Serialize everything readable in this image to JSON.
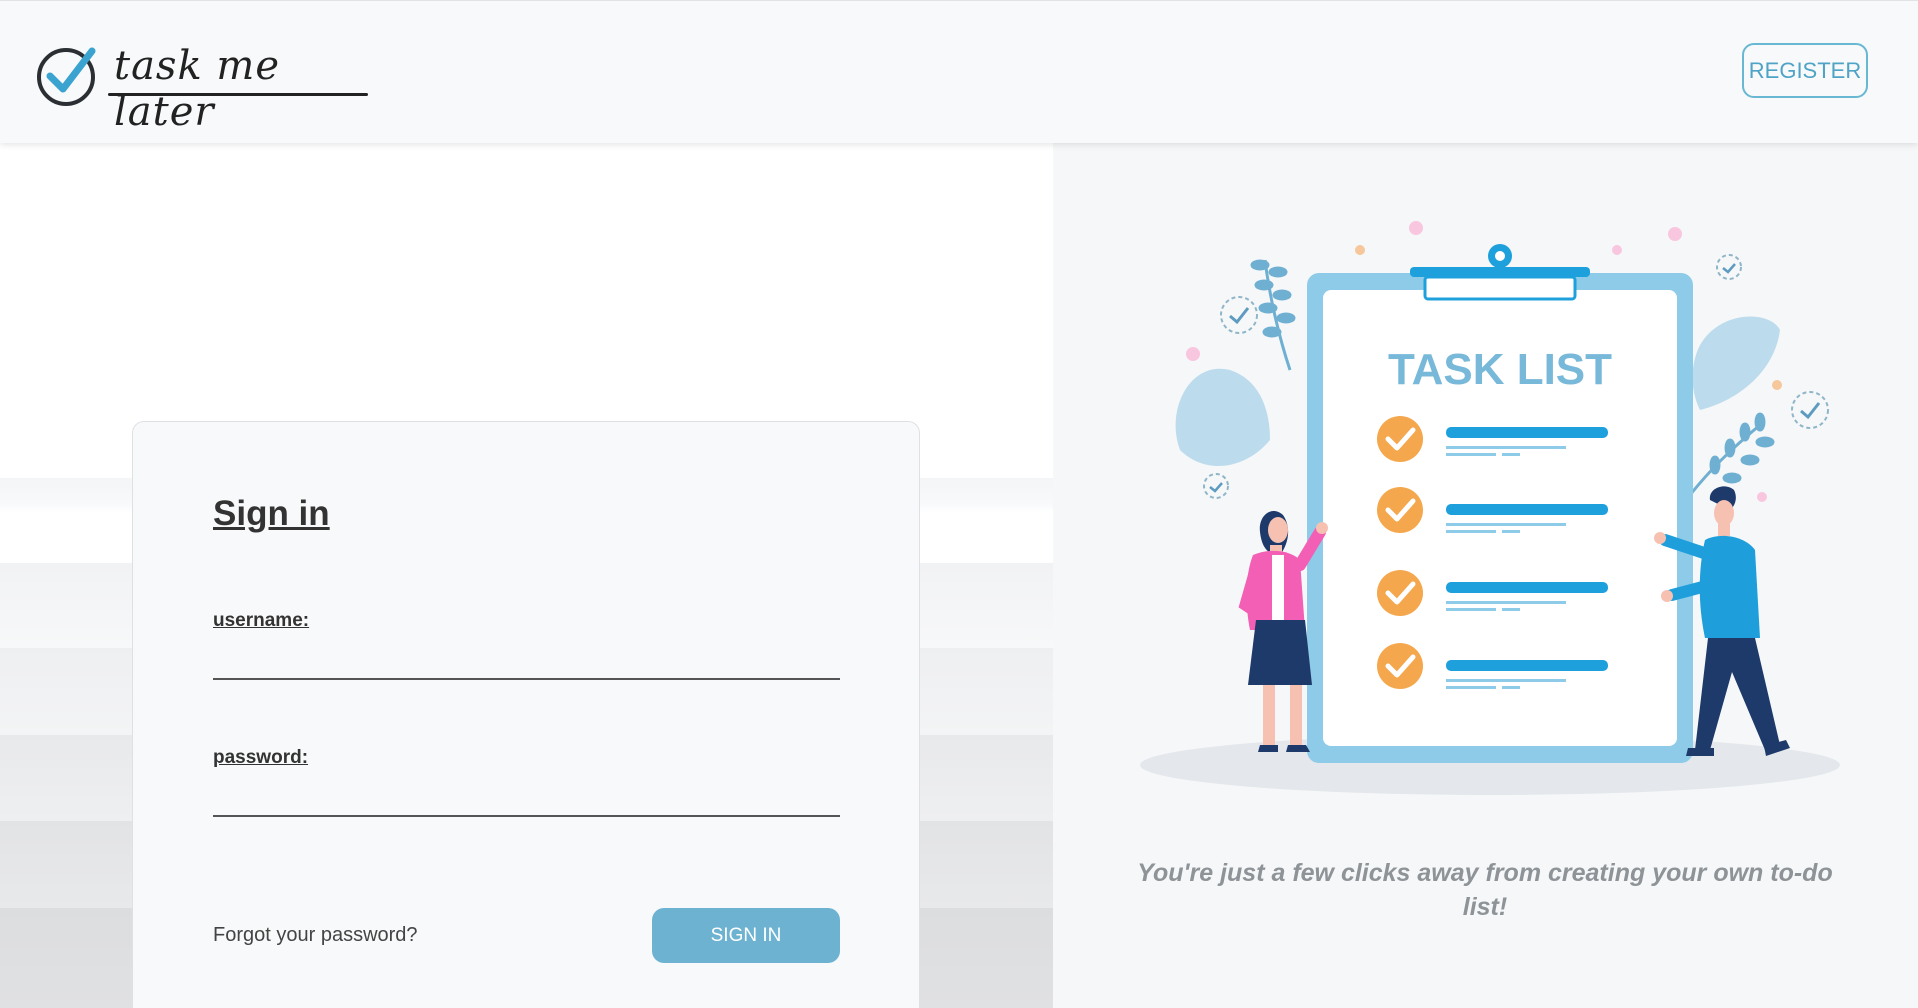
{
  "header": {
    "logo_text": "task me later",
    "register_label": "REGISTER"
  },
  "signin_card": {
    "title": "Sign in",
    "username_label": "username:",
    "username_value": "",
    "password_label": "password:",
    "password_value": "",
    "forgot_label": "Forgot your password?",
    "signin_label": "SIGN IN"
  },
  "illustration": {
    "heading": "TASK LIST",
    "icon": "clipboard-task-list-illustration"
  },
  "tagline": "You're just a few clicks away from creating your own to-do list!",
  "colors": {
    "accent": "#6db3d1",
    "accent_border": "#68b7d3",
    "check_orange": "#f4a74c",
    "task_blue": "#1ea0dc"
  }
}
